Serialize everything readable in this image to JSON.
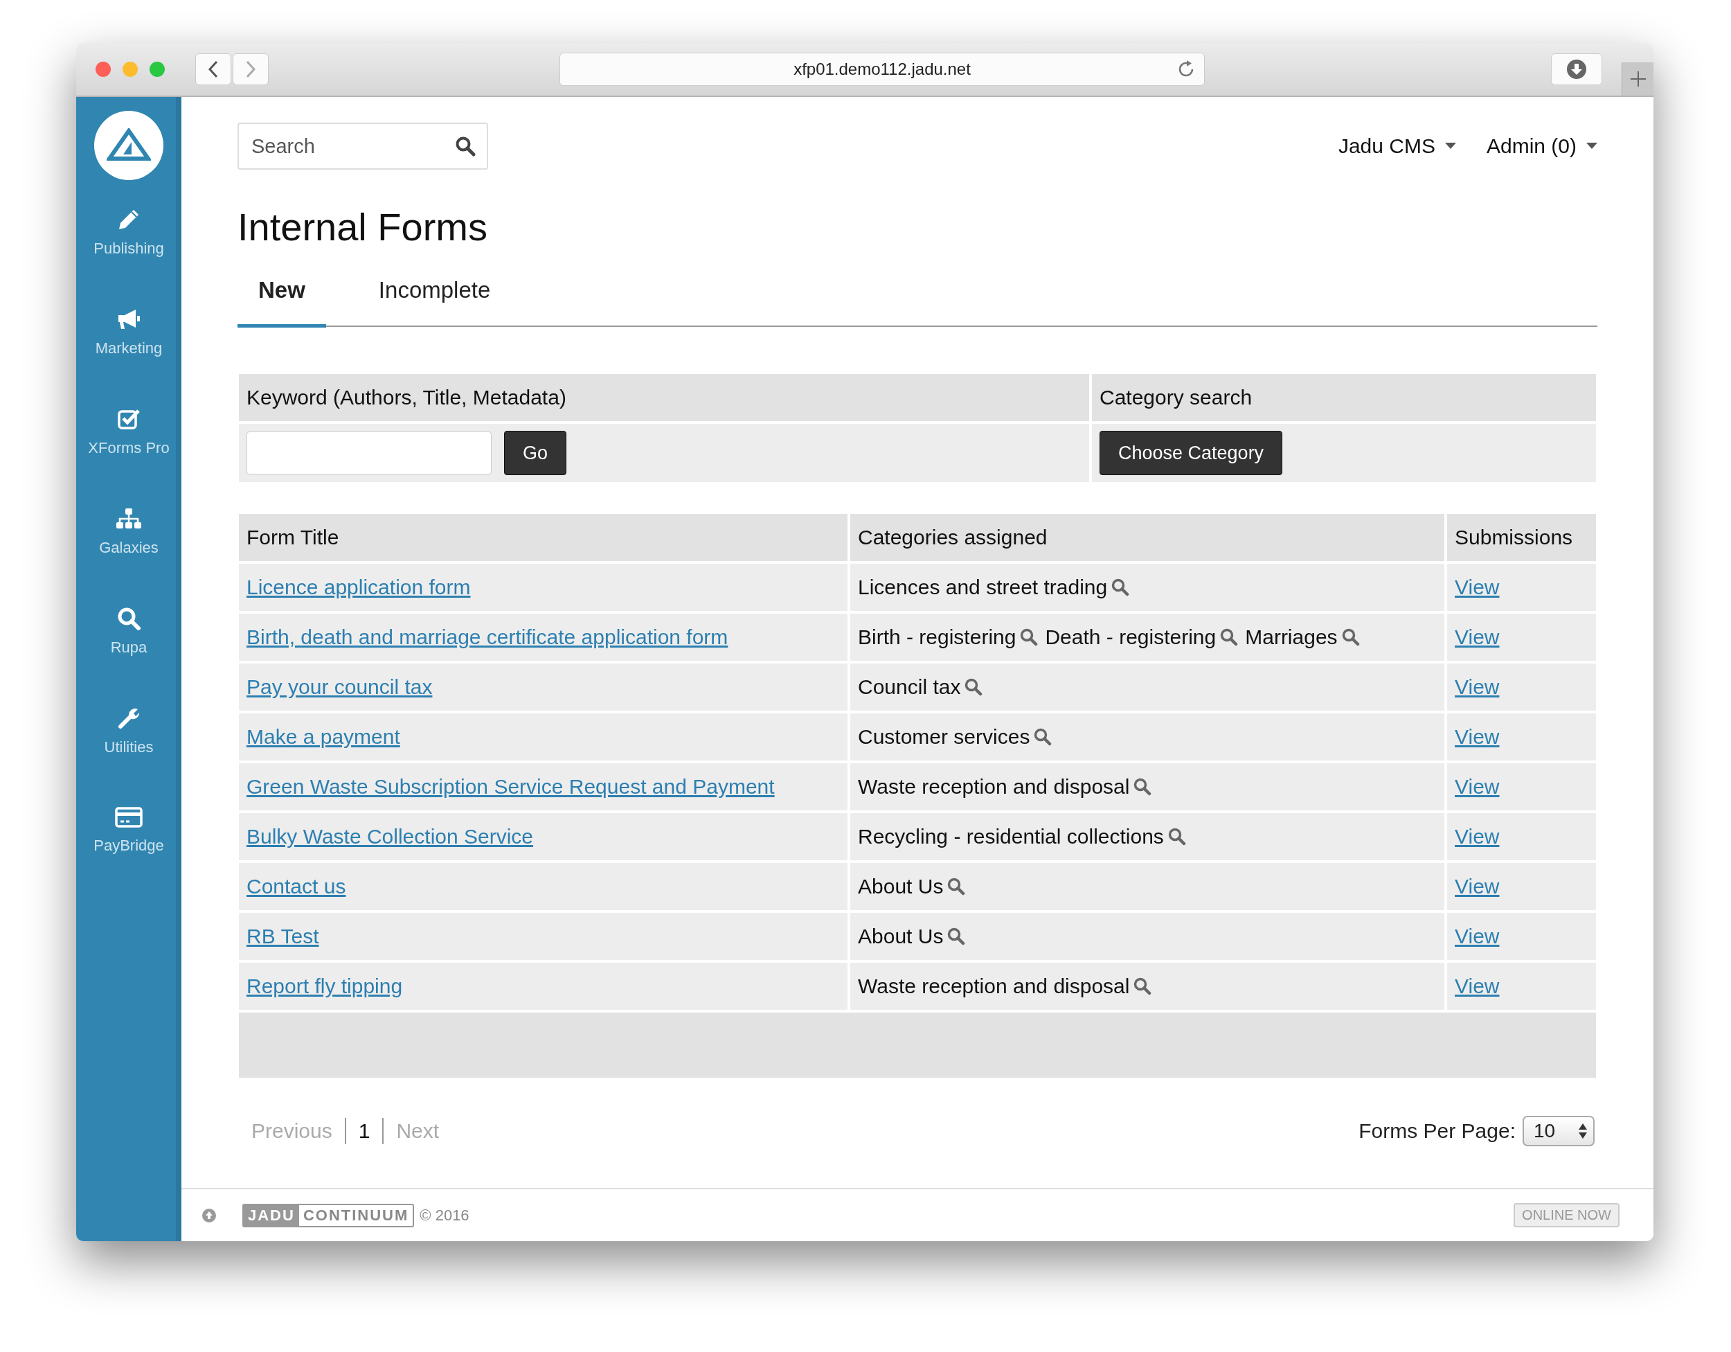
{
  "browser": {
    "url": "xfp01.demo112.jadu.net"
  },
  "sidebar": {
    "items": [
      {
        "kind": "pencil",
        "label": "Publishing"
      },
      {
        "kind": "megaphone",
        "label": "Marketing"
      },
      {
        "kind": "checkbox",
        "label": "XForms Pro"
      },
      {
        "kind": "sitemap",
        "label": "Galaxies"
      },
      {
        "kind": "search",
        "label": "Rupa"
      },
      {
        "kind": "wrench",
        "label": "Utilities"
      },
      {
        "kind": "card",
        "label": "PayBridge"
      }
    ]
  },
  "topbar": {
    "search": {
      "placeholder": "Search"
    },
    "menus": [
      "Jadu CMS",
      "Admin (0)"
    ]
  },
  "title": "Internal Forms",
  "tabs": [
    {
      "label": "New",
      "selected": true
    },
    {
      "label": "Incomplete",
      "selected": false
    }
  ],
  "filter": {
    "keyword_label": "Keyword (Authors, Title, Metadata)",
    "go_button": "Go",
    "category_label": "Category search",
    "category_button": "Choose Category"
  },
  "table": {
    "columns": [
      "Form Title",
      "Categories assigned",
      "Submissions"
    ],
    "rows": [
      {
        "title": "Licence application form",
        "categories": [
          "Licences and street trading"
        ],
        "submissions": "View"
      },
      {
        "title": "Birth, death and marriage certificate application form",
        "categories": [
          "Birth - registering",
          "Death - registering",
          "Marriages"
        ],
        "submissions": "View"
      },
      {
        "title": "Pay your council tax",
        "categories": [
          "Council tax"
        ],
        "submissions": "View"
      },
      {
        "title": "Make a payment",
        "categories": [
          "Customer services"
        ],
        "submissions": "View"
      },
      {
        "title": "Green Waste Subscription Service Request and Payment",
        "categories": [
          "Waste reception and disposal"
        ],
        "submissions": "View"
      },
      {
        "title": "Bulky Waste Collection Service",
        "categories": [
          "Recycling - residential collections"
        ],
        "submissions": "View"
      },
      {
        "title": "Contact us",
        "categories": [
          "About Us"
        ],
        "submissions": "View"
      },
      {
        "title": "RB Test",
        "categories": [
          "About Us"
        ],
        "submissions": "View"
      },
      {
        "title": "Report fly tipping",
        "categories": [
          "Waste reception and disposal"
        ],
        "submissions": "View"
      }
    ]
  },
  "pagination": {
    "previous": {
      "label": "Previous",
      "disabled": true
    },
    "page": "1",
    "next": {
      "label": "Next",
      "disabled": true
    },
    "per_page_label": "Forms Per Page:",
    "per_page_value": "10"
  },
  "footer": {
    "logo": [
      "JADU",
      "CONTINUUM"
    ],
    "copyright": "© 2016",
    "status": "ONLINE NOW"
  }
}
